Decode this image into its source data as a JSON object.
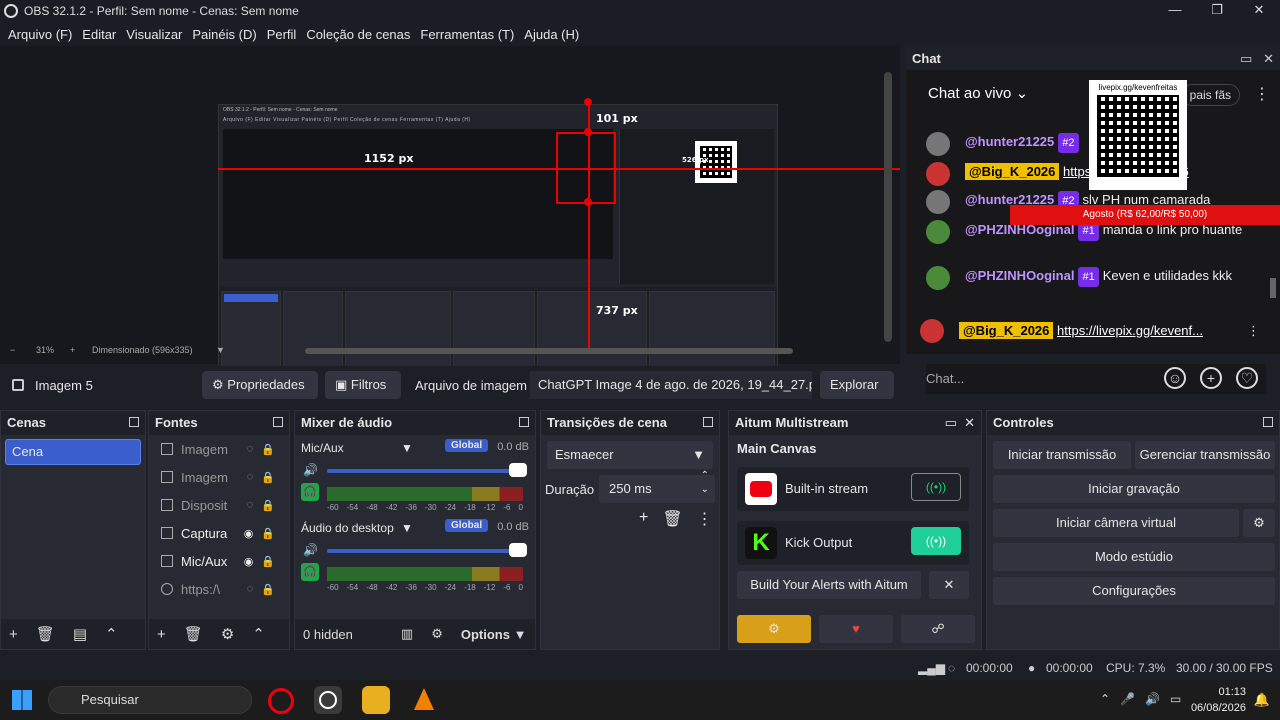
{
  "window": {
    "title": "OBS 32.1.2 - Perfil: Sem nome - Cenas: Sem nome",
    "min": "—",
    "max": "❐",
    "close": "✕"
  },
  "menu": [
    "Arquivo (F)",
    "Editar",
    "Visualizar",
    "Painéis (D)",
    "Perfil",
    "Coleção de cenas",
    "Ferramentas (T)",
    "Ajuda (H)"
  ],
  "preview": {
    "measures": {
      "top": "101 px",
      "left": "1152 px",
      "right": "526 px",
      "bottom": "737 px"
    },
    "nested_title": "OBS 32.1.2 - Perfil: Sem nome - Cenas: Sem nome",
    "nested_menu": "Arquivo (F)   Editar   Visualizar   Painéis (D)   Perfil   Coleção de cenas   Ferramentas (T)   Ajuda (H)",
    "zoom": "31%",
    "size_label": "Dimensionado (596x335)",
    "minus": "−",
    "plus": "+"
  },
  "source_bar": {
    "name": "Imagem 5",
    "properties": "Propriedades",
    "filters": "Filtros",
    "file_label": "Arquivo de imagem",
    "file_value": "ChatGPT Image 4 de ago. de 2026, 19_44_27.png",
    "explore": "Explorar"
  },
  "chat": {
    "header": "Chat",
    "live_label": "Chat ao vivo",
    "top_fans": "pais fãs",
    "qr_url": "livepix.gg/kevenfreitas",
    "qr_url2": "livepix.gg/kevenfreitas",
    "banner": "Agosto (R$ 62,00/R$ 50,00)",
    "messages": [
      {
        "user": "@hunter21225",
        "badge": "#2",
        "text": ""
      },
      {
        "user": "@Big_K_2026",
        "badge": "",
        "text": "https://livepix.gg/2026"
      },
      {
        "user": "@hunter21225",
        "badge": "#2",
        "text": "slv PH num camarada"
      },
      {
        "user": "@PHZINHOoginal",
        "badge": "#1",
        "text": "manda o link pro huante"
      },
      {
        "user": "@PHZINHOoginal",
        "badge": "#1",
        "text": "Keven e utilidades kkk"
      }
    ],
    "pinned_user": "@Big_K_2026",
    "pinned_link": "https://livepix.gg/kevenf...",
    "input_placeholder": "Chat..."
  },
  "docks": {
    "scenes": {
      "title": "Cenas",
      "items": [
        "Cena"
      ]
    },
    "sources": {
      "title": "Fontes",
      "items": [
        "Imagem",
        "Imagem",
        "Disposit",
        "Captura",
        "Mic/Aux",
        "https:/\\"
      ]
    },
    "mixer": {
      "title": "Mixer de áudio",
      "channels": [
        {
          "name": "Mic/Aux",
          "global": "Global",
          "db": "0.0 dB"
        },
        {
          "name": "Áudio do desktop",
          "global": "Global",
          "db": "0.0 dB"
        }
      ],
      "scale": [
        "-60",
        "-54",
        "-48",
        "-42",
        "-36",
        "-30",
        "-24",
        "-18",
        "-12",
        "-6",
        "0"
      ],
      "hidden": "0 hidden",
      "options": "Options"
    },
    "transitions": {
      "title": "Transições de cena",
      "selected": "Esmaecer",
      "duration_label": "Duração",
      "duration_value": "250 ms"
    },
    "multistream": {
      "title": "Aitum Multistream",
      "section": "Main Canvas",
      "outputs": [
        {
          "name": "Built-in stream",
          "active": false
        },
        {
          "name": "Kick Output",
          "active": true
        }
      ],
      "alerts_button": "Build Your Alerts with Aitum"
    },
    "controls": {
      "title": "Controles",
      "start_stream": "Iniciar transmissão",
      "manage_stream": "Gerenciar transmissão",
      "start_record": "Iniciar gravação",
      "virtual_cam": "Iniciar câmera virtual",
      "studio_mode": "Modo estúdio",
      "settings": "Configurações"
    }
  },
  "status": {
    "stream_time": "00:00:00",
    "rec_time": "00:00:00",
    "cpu": "CPU: 7.3%",
    "fps": "30.00 / 30.00 FPS"
  },
  "taskbar": {
    "search": "Pesquisar",
    "time": "01:13",
    "date": "06/08/2026"
  }
}
